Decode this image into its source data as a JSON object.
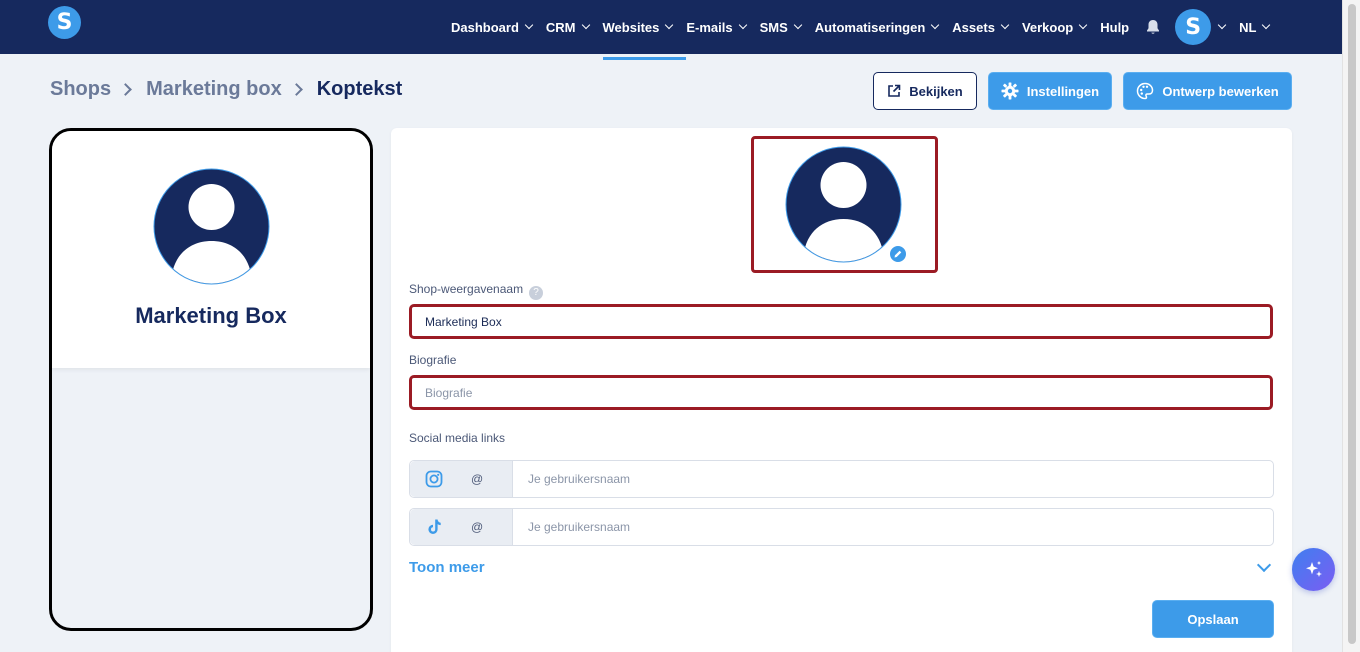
{
  "app": {
    "logo_letter": "S",
    "colors": {
      "nav_bg": "#16295e",
      "accent": "#3d9be9",
      "error_border": "#9b1b24"
    }
  },
  "nav": {
    "items": [
      {
        "label": "Dashboard",
        "has_dropdown": true,
        "active": false
      },
      {
        "label": "CRM",
        "has_dropdown": true,
        "active": false
      },
      {
        "label": "Websites",
        "has_dropdown": true,
        "active": true
      },
      {
        "label": "E-mails",
        "has_dropdown": true,
        "active": false
      },
      {
        "label": "SMS",
        "has_dropdown": true,
        "active": false
      },
      {
        "label": "Automatiseringen",
        "has_dropdown": true,
        "active": false
      },
      {
        "label": "Assets",
        "has_dropdown": true,
        "active": false
      },
      {
        "label": "Verkoop",
        "has_dropdown": true,
        "active": false
      },
      {
        "label": "Hulp",
        "has_dropdown": false,
        "active": false
      }
    ],
    "notification_icon": "bell-icon",
    "user_avatar_letter": "S",
    "language": "NL"
  },
  "breadcrumb": {
    "items": [
      "Shops",
      "Marketing box",
      "Koptekst"
    ]
  },
  "actions": {
    "view_label": "Bekijken",
    "settings_label": "Instellingen",
    "design_label": "Ontwerp bewerken"
  },
  "preview": {
    "shop_name": "Marketing Box"
  },
  "form": {
    "display_name_label": "Shop-weergavenaam",
    "display_name_value": "Marketing Box",
    "bio_label": "Biografie",
    "bio_placeholder": "Biografie",
    "social_label": "Social media links",
    "social_links": [
      {
        "icon": "instagram-icon",
        "prefix": "@",
        "placeholder": "Je gebruikersnaam"
      },
      {
        "icon": "tiktok-icon",
        "prefix": "@",
        "placeholder": "Je gebruikersnaam"
      }
    ],
    "show_more_label": "Toon meer",
    "save_label": "Opslaan"
  }
}
